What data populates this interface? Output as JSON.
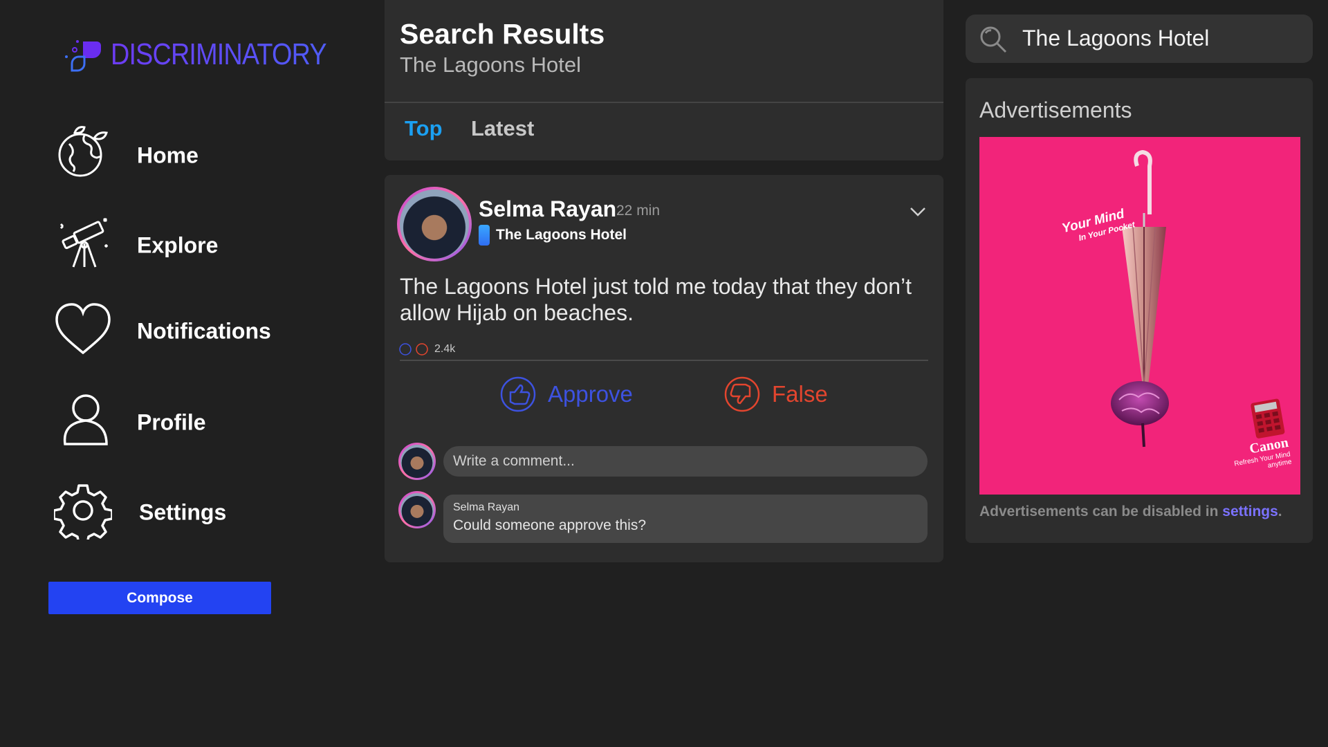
{
  "app": {
    "brand": "DISCRIMINATORY"
  },
  "sidebar": {
    "items": [
      {
        "label": "Home",
        "icon": "globe-leaf-icon"
      },
      {
        "label": "Explore",
        "icon": "telescope-icon"
      },
      {
        "label": "Notifications",
        "icon": "heart-icon"
      },
      {
        "label": "Profile",
        "icon": "user-icon"
      },
      {
        "label": "Settings",
        "icon": "gear-icon"
      }
    ],
    "compose_label": "Compose"
  },
  "results": {
    "title": "Search Results",
    "query": "The Lagoons Hotel",
    "tabs": [
      {
        "label": "Top",
        "active": true
      },
      {
        "label": "Latest",
        "active": false
      }
    ]
  },
  "post": {
    "author": "Selma Rayan",
    "time": "22 min",
    "location": "The Lagoons Hotel",
    "body": "The Lagoons Hotel just told me today that they don’t allow Hijab on beaches.",
    "reaction_count": "2.4k",
    "approve_label": "Approve",
    "false_label": "False",
    "comment_placeholder": "Write a comment...",
    "comments": [
      {
        "author": "Selma Rayan",
        "text": "Could someone approve this?"
      }
    ]
  },
  "search": {
    "value": "The Lagoons Hotel"
  },
  "ads": {
    "title": "Advertisements",
    "ad": {
      "tagline_1": "Your Mind",
      "tagline_2": "In Your Pocket",
      "brand": "Canon",
      "brand_tagline_1": "Refresh Your Mind",
      "brand_tagline_2": "anytime"
    },
    "note_prefix": "Advertisements can be disabled in ",
    "note_link": "settings",
    "note_suffix": "."
  },
  "colors": {
    "background": "#202020",
    "card": "#2d2d2d",
    "accent_blue": "#2343f2",
    "tab_active": "#1ba0f2",
    "approve": "#3d52e0",
    "false": "#e3452e",
    "link": "#7b72ff",
    "ad_background": "#f2247a"
  }
}
